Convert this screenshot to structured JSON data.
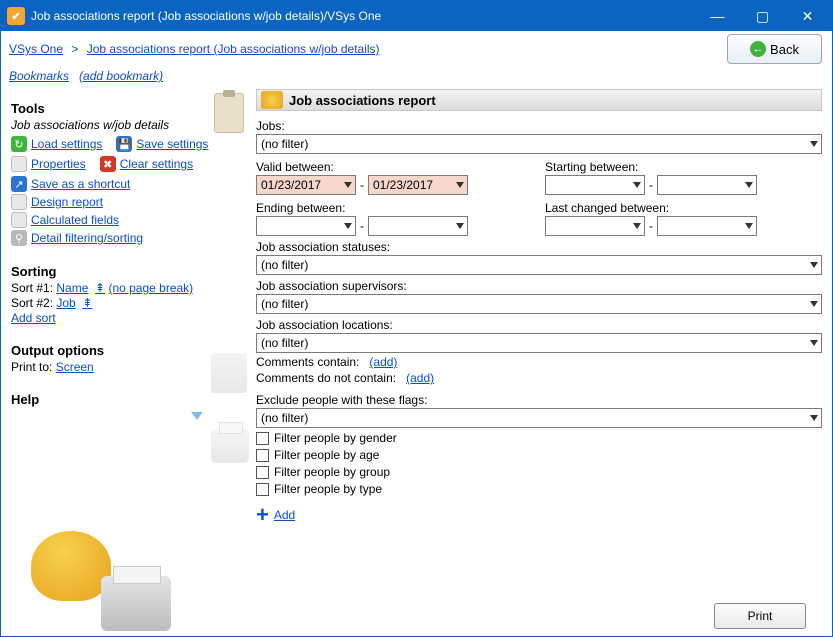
{
  "window_title": "Job associations report (Job associations w/job details)/VSys One",
  "breadcrumb": {
    "root": "VSys One",
    "current": "Job associations report (Job associations w/job details)"
  },
  "bookmarks": {
    "label": "Bookmarks",
    "add": "(add bookmark)"
  },
  "back_label": "Back",
  "sidebar": {
    "tools_heading": "Tools",
    "context": "Job associations w/job details",
    "links": {
      "load": "Load settings",
      "save": "Save settings",
      "properties": "Properties",
      "clear": "Clear settings",
      "shortcut": "Save as a shortcut",
      "design": "Design report",
      "calc": "Calculated fields",
      "filter": "Detail filtering/sorting"
    },
    "sorting_heading": "Sorting",
    "sort1_prefix": "Sort #1: ",
    "sort1_field": "Name",
    "sort1_suffix": "(no page break)",
    "sort2_prefix": "Sort #2: ",
    "sort2_field": "Job",
    "add_sort": "Add sort",
    "output_heading": "Output options",
    "print_to_prefix": "Print to: ",
    "print_to_value": "Screen",
    "help_heading": "Help"
  },
  "main": {
    "header": "Job associations report",
    "jobs_label": "Jobs:",
    "jobs_value": "(no filter)",
    "valid_between": "Valid between:",
    "valid_from": "01/23/2017",
    "valid_to": "01/23/2017",
    "starting_between": "Starting between:",
    "ending_between": "Ending between:",
    "last_changed": "Last changed between:",
    "statuses_label": "Job association statuses:",
    "statuses_value": "(no filter)",
    "supervisors_label": "Job association supervisors:",
    "supervisors_value": "(no filter)",
    "locations_label": "Job association locations:",
    "locations_value": "(no filter)",
    "comments_contain": "Comments contain:",
    "comments_not_contain": "Comments do not contain:",
    "add_link": "(add)",
    "exclude_label": "Exclude people with these flags:",
    "exclude_value": "(no filter)",
    "cb_gender": "Filter people by gender",
    "cb_age": "Filter people by age",
    "cb_group": "Filter people by group",
    "cb_type": "Filter people by type",
    "add_label": "Add"
  },
  "footer": {
    "print": "Print"
  }
}
